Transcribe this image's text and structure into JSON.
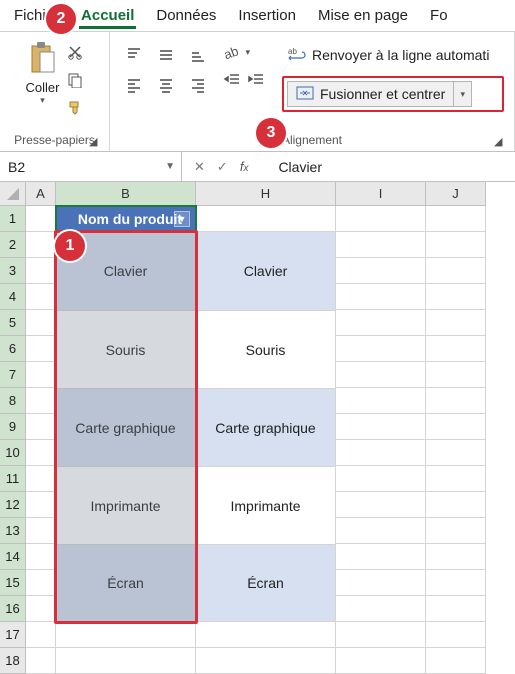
{
  "tabs": {
    "file": "Fichier",
    "home": "Accueil",
    "data": "Données",
    "insert": "Insertion",
    "layout": "Mise en page",
    "formulas_initial": "Fo"
  },
  "ribbon": {
    "clipboard": {
      "paste": "Coller",
      "group_label": "Presse-papiers"
    },
    "alignment": {
      "wrap_text": "Renvoyer à la ligne automati",
      "merge_center": "Fusionner et centrer",
      "group_label": "Alignement"
    }
  },
  "steps": {
    "one": "1",
    "two": "2",
    "three": "3"
  },
  "namebox": {
    "ref": "B2"
  },
  "formula_bar": {
    "value": "Clavier"
  },
  "columns": {
    "a": "A",
    "b": "B",
    "h": "H",
    "i": "I",
    "j": "J"
  },
  "row_labels": [
    "1",
    "2",
    "3",
    "4",
    "5",
    "6",
    "7",
    "8",
    "9",
    "10",
    "11",
    "12",
    "13",
    "14",
    "15",
    "16",
    "17",
    "18"
  ],
  "table": {
    "header": "Nom du produit",
    "col_b": [
      "Clavier",
      "Souris",
      "Carte graphique",
      "Imprimante",
      "Écran"
    ],
    "col_h": [
      "Clavier",
      "Souris",
      "Carte graphique",
      "Imprimante",
      "Écran"
    ]
  }
}
